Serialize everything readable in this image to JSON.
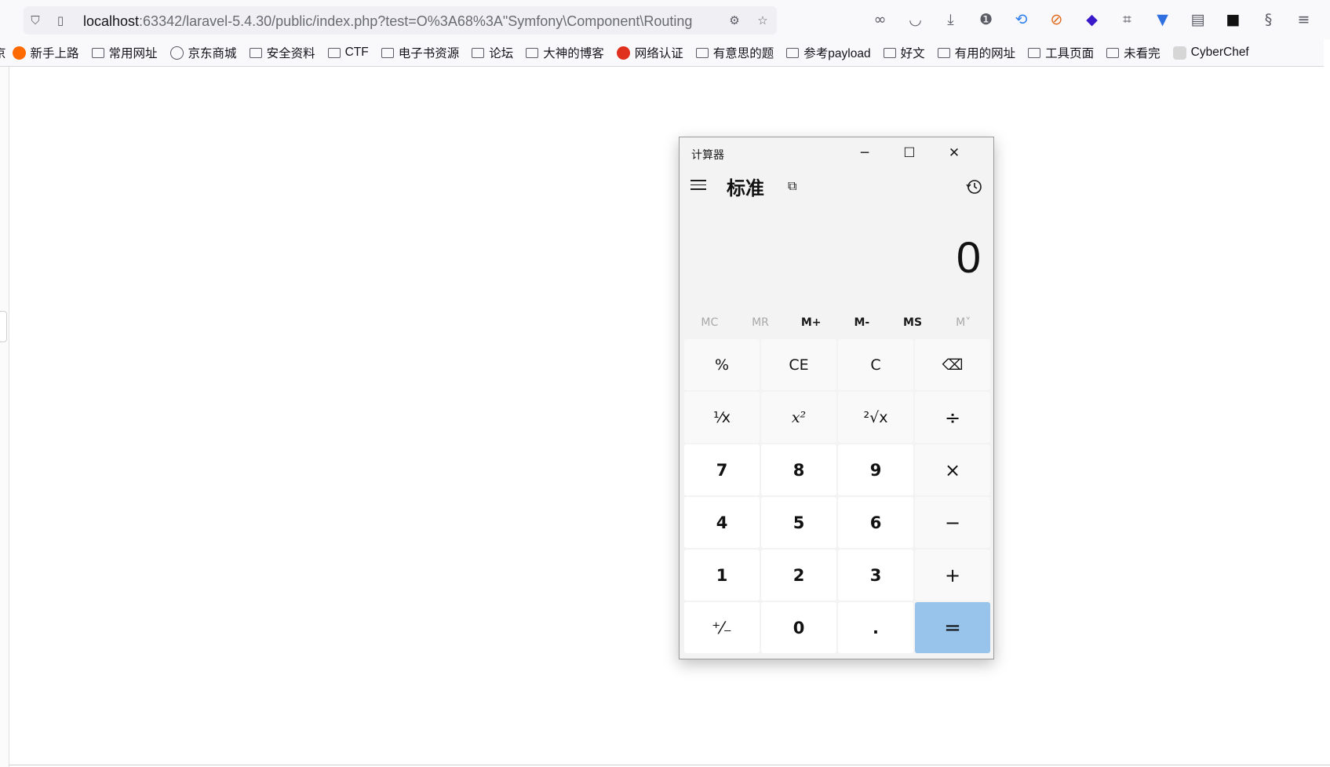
{
  "browser": {
    "url_host": "localhost",
    "url_rest": ":63342/laravel-5.4.30/public/index.php?test=O%3A68%3A\"Symfony\\Component\\Routing",
    "bookmarks": [
      "京",
      "新手上路",
      "常用网址",
      "京东商城",
      "安全资料",
      "CTF",
      "电子书资源",
      "论坛",
      "大神的博客",
      "网络认证",
      "有意思的题",
      "参考payload",
      "好文",
      "有用的网址",
      "工具页面",
      "未看完",
      "CyberChef"
    ]
  },
  "calculator": {
    "title": "计算器",
    "mode": "标准",
    "display": "0",
    "memory_buttons": [
      {
        "label": "MC",
        "enabled": false
      },
      {
        "label": "MR",
        "enabled": false
      },
      {
        "label": "M+",
        "enabled": true
      },
      {
        "label": "M-",
        "enabled": true
      },
      {
        "label": "MS",
        "enabled": true
      },
      {
        "label": "M˅",
        "enabled": false
      }
    ],
    "keys": [
      "%",
      "CE",
      "C",
      "⌫",
      "¹⁄x",
      "x²",
      "²√x",
      "÷",
      "7",
      "8",
      "9",
      "×",
      "4",
      "5",
      "6",
      "−",
      "1",
      "2",
      "3",
      "+",
      "⁺⁄₋",
      "0",
      ".",
      "="
    ],
    "accent_color": "#98c3ea"
  }
}
